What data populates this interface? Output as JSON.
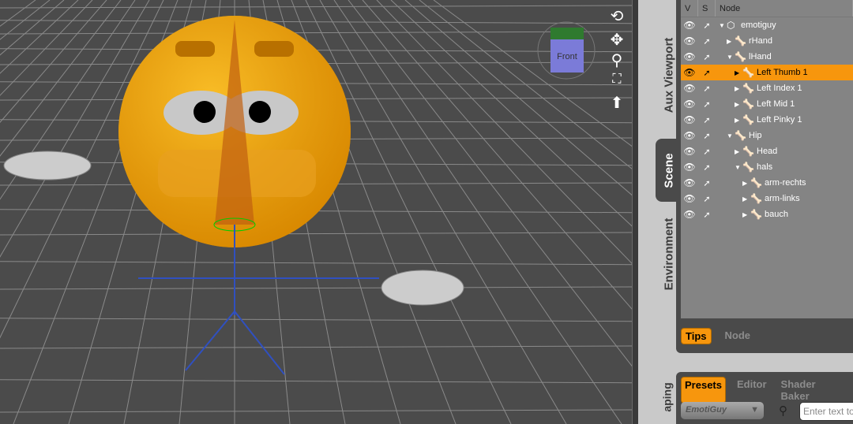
{
  "viewport": {
    "cube_label": "Front",
    "nav_icons": [
      "orbit-icon",
      "pan-icon",
      "zoom-icon",
      "frame-icon",
      "reset-icon"
    ]
  },
  "side_tabs": [
    "Aux Viewport",
    "Scene",
    "Environment"
  ],
  "scene": {
    "columns": [
      "V",
      "S",
      "Node"
    ],
    "nodes": [
      {
        "label": "emotiguy",
        "depth": 0,
        "expanded": true,
        "icon": "figure-icon"
      },
      {
        "label": "rHand",
        "depth": 1,
        "expanded": false,
        "icon": "bone-icon"
      },
      {
        "label": "lHand",
        "depth": 1,
        "expanded": true,
        "icon": "bone-icon"
      },
      {
        "label": "Left Thumb 1",
        "depth": 2,
        "expanded": false,
        "icon": "bone-icon",
        "selected": true
      },
      {
        "label": "Left Index 1",
        "depth": 2,
        "expanded": false,
        "icon": "bone-icon"
      },
      {
        "label": "Left Mid 1",
        "depth": 2,
        "expanded": false,
        "icon": "bone-icon"
      },
      {
        "label": "Left Pinky 1",
        "depth": 2,
        "expanded": false,
        "icon": "bone-icon"
      },
      {
        "label": "Hip",
        "depth": 1,
        "expanded": true,
        "icon": "bone-icon"
      },
      {
        "label": "Head",
        "depth": 2,
        "expanded": false,
        "icon": "bone-icon"
      },
      {
        "label": "hals",
        "depth": 2,
        "expanded": true,
        "icon": "bone-icon"
      },
      {
        "label": "arm-rechts",
        "depth": 3,
        "expanded": false,
        "icon": "bone-icon"
      },
      {
        "label": "arm-links",
        "depth": 3,
        "expanded": false,
        "icon": "bone-icon"
      },
      {
        "label": "bauch",
        "depth": 3,
        "expanded": false,
        "icon": "bone-icon"
      }
    ],
    "bottom_tabs": [
      {
        "label": "Tips",
        "active": true
      },
      {
        "label": "Node",
        "active": false
      }
    ]
  },
  "lower": {
    "side_tab": "aping",
    "tabs": [
      {
        "label": "Presets",
        "active": true
      },
      {
        "label": "Editor",
        "active": false
      },
      {
        "label": "Shader Baker",
        "active": false
      }
    ],
    "filter_value": "EmotiGuy",
    "search_placeholder": "Enter text to"
  },
  "colors": {
    "accent": "#f7960d",
    "viewport": "#4b4b4b",
    "tree": "#848484"
  }
}
